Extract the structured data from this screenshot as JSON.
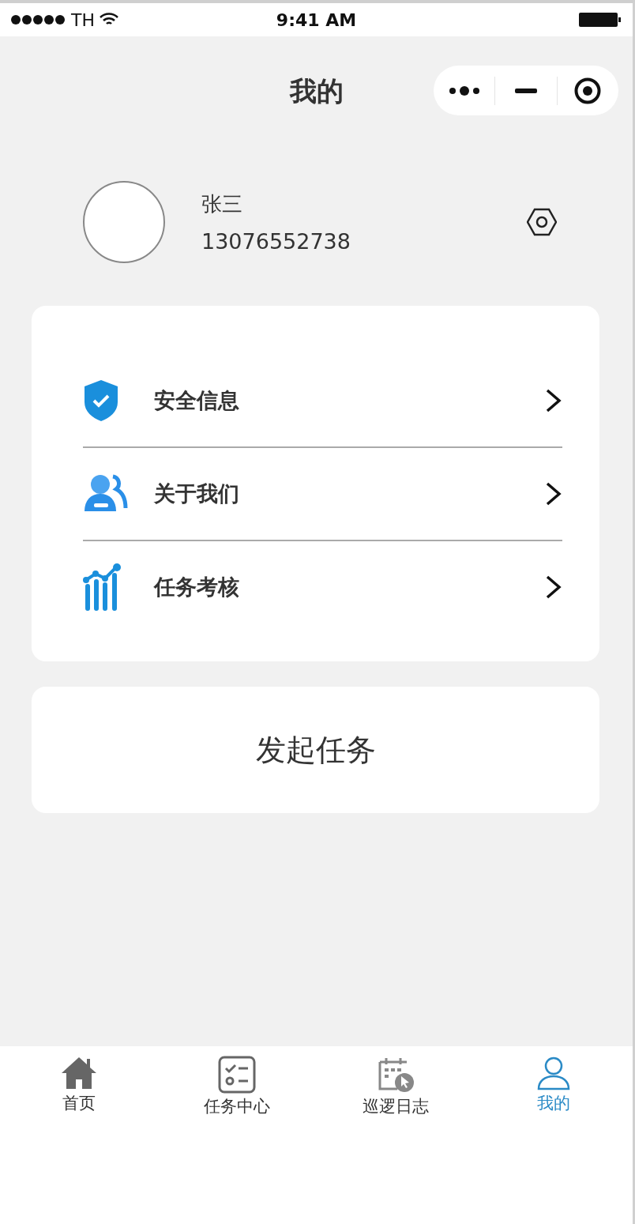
{
  "status_bar": {
    "carrier": "TH",
    "time": "9:41 AM"
  },
  "nav_bar": {
    "title": "我的"
  },
  "profile": {
    "name": "张三",
    "phone": "13076552738"
  },
  "menu": [
    {
      "kind": "shield",
      "label": "安全信息"
    },
    {
      "kind": "people",
      "label": "关于我们"
    },
    {
      "kind": "chart",
      "label": "任务考核"
    }
  ],
  "action": {
    "label": "发起任务"
  },
  "tab_bar": [
    {
      "kind": "home",
      "label": "首页",
      "selected": false
    },
    {
      "kind": "tasks",
      "label": "任务中心",
      "selected": false
    },
    {
      "kind": "calendar",
      "label": "巡逻日志",
      "selected": false
    },
    {
      "kind": "user",
      "label": "我的",
      "selected": true
    }
  ]
}
